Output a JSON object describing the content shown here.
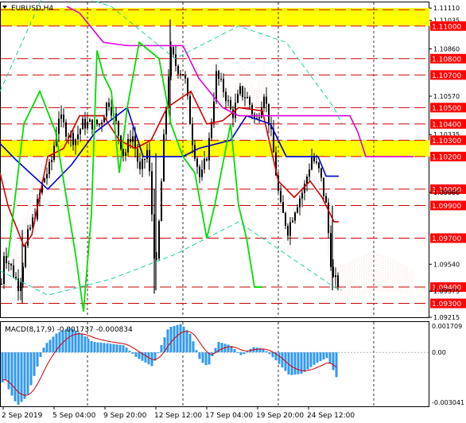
{
  "chart_title": "EURUSD,H4",
  "indicator_label": "MACD(8,17,9) -0.001737 -0.000834",
  "colors": {
    "zone": "#ffff00",
    "level": "#cc0000",
    "price_tag_bg": "#ff0000",
    "candle": "#000000",
    "tenkan": "#cc0000",
    "kijun": "#0000cc",
    "chikou": "#00dd00",
    "senkou_b": "#dd00dd",
    "envelope": "#00cc99",
    "histogram": "#3399ee",
    "signal": "#cc0000"
  },
  "chart_data": {
    "type": "candlestick",
    "title": "EURUSD,H4",
    "price_axis_ticks": [
      "1.11110",
      "1.11035",
      "1.11000",
      "1.10860",
      "1.10800",
      "1.10700",
      "1.10570",
      "1.10500",
      "1.10400",
      "1.10335",
      "1.10300",
      "1.10200",
      "1.10000",
      "1.09980",
      "1.09900",
      "1.09700",
      "1.09540",
      "1.09400",
      "1.09375",
      "1.09300",
      "1.09215"
    ],
    "highlighted_levels": [
      "1.11100",
      "1.11000",
      "1.10800",
      "1.10700",
      "1.10500",
      "1.10400",
      "1.10300",
      "1.10200",
      "1.10000",
      "1.09900",
      "1.09700",
      "1.09400",
      "1.09300"
    ],
    "yellow_zones": [
      [
        1.11,
        1.1111
      ],
      [
        1.102,
        1.103
      ]
    ],
    "ylim": [
      1.09215,
      1.11145
    ],
    "time_labels": [
      "2 Sep 2019",
      "5 Sep 04:00",
      "9 Sep 20:00",
      "12 Sep 12:00",
      "17 Sep 04:00",
      "19 Sep 20:00",
      "24 Sep 12:00"
    ],
    "macd": {
      "label": "MACD(8,17,9) -0.001737 -0.000834",
      "ticks": [
        "0.001709",
        "0.00",
        "-0.003041"
      ],
      "ylim": [
        -0.003041,
        0.001709
      ]
    }
  }
}
